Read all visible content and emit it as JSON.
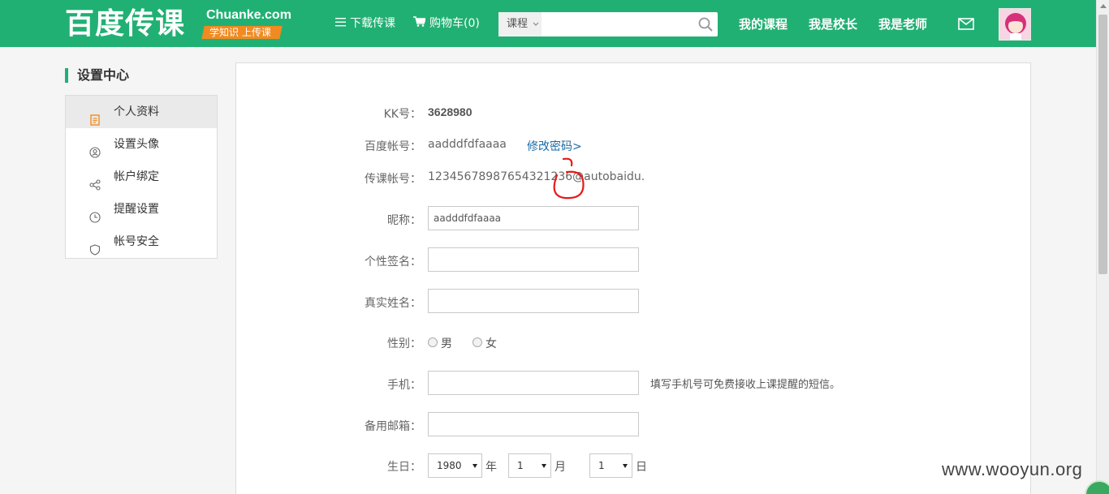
{
  "header": {
    "logo_cn": "百度传课",
    "logo_en": "Chuanke.com",
    "logo_slogan": "学知识 上传课",
    "download": "下载传课",
    "cart": "购物车(0)",
    "search": {
      "category": "课程",
      "value": "",
      "icon": "search-icon"
    },
    "my_courses": "我的课程",
    "principal": "我是校长",
    "teacher": "我是老师",
    "mail_icon": "mail-icon",
    "brand_color": "#21b073"
  },
  "sidebar": {
    "title": "设置中心",
    "items": [
      {
        "label": "个人资料",
        "icon": "document-icon",
        "active": true
      },
      {
        "label": "设置头像",
        "icon": "avatar-icon",
        "active": false
      },
      {
        "label": "帐户绑定",
        "icon": "share-icon",
        "active": false
      },
      {
        "label": "提醒设置",
        "icon": "clock-icon",
        "active": false
      },
      {
        "label": "帐号安全",
        "icon": "shield-icon",
        "active": false
      }
    ]
  },
  "profile": {
    "kk_label": "KK号：",
    "kk_value": "3628980",
    "baidu_label": "百度帐号：",
    "baidu_value": "aadddfdfaaaa",
    "change_password": "修改密码>",
    "chuanke_label": "传课帐号：",
    "chuanke_value": "12345678987654321236@autobaidu.",
    "nickname_label": "昵称：",
    "nickname_value": "aadddfdfaaaa",
    "signature_label": "个性签名：",
    "signature_value": "",
    "realname_label": "真实姓名：",
    "realname_value": "",
    "gender_label": "性别：",
    "gender_male": "男",
    "gender_female": "女",
    "phone_label": "手机：",
    "phone_value": "",
    "phone_hint": "填写手机号可免费接收上课提醒的短信。",
    "email_label": "备用邮箱：",
    "email_value": "",
    "birthday_label": "生日：",
    "birth_year": "1980",
    "year_unit": "年",
    "birth_month": "1",
    "month_unit": "月",
    "birth_day": "1",
    "day_unit": "日"
  },
  "watermark": "www.wooyun.org"
}
